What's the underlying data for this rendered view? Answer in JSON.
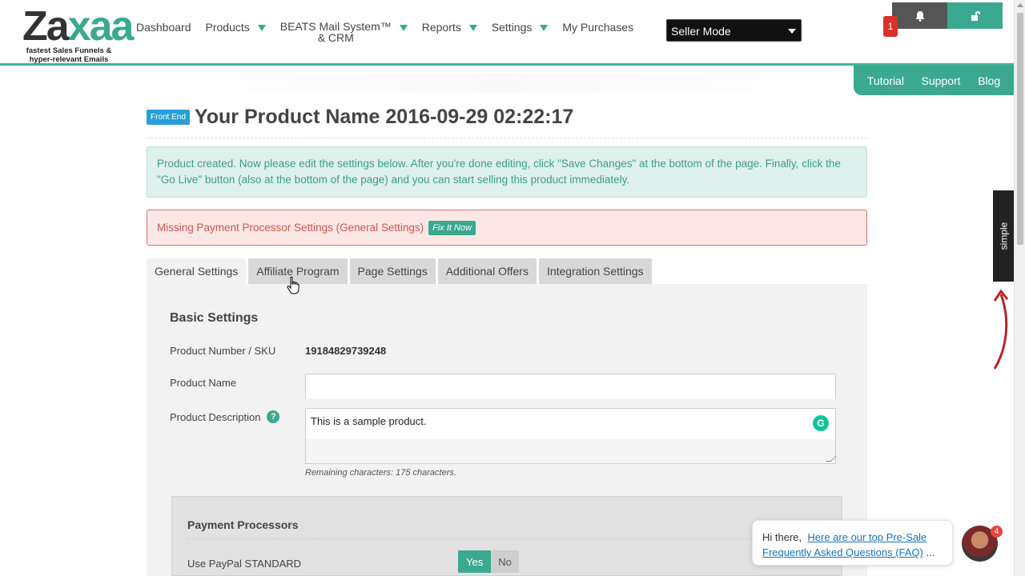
{
  "brand": {
    "logo_part1": "Za",
    "logo_part2": "xaa",
    "tagline_line1": "fastest Sales Funnels &",
    "tagline_line2": "hyper-relevant Emails"
  },
  "nav": {
    "dashboard": "Dashboard",
    "products": "Products",
    "beats_line1": "BEATS Mail System™",
    "beats_line2": "& CRM",
    "reports": "Reports",
    "settings": "Settings",
    "purchases": "My Purchases",
    "mode_selected": "Seller Mode",
    "notification_count": "1"
  },
  "subnav": {
    "tutorial": "Tutorial",
    "support": "Support",
    "blog": "Blog"
  },
  "product": {
    "badge": "Front End",
    "title": "Your Product Name 2016-09-29 02:22:17"
  },
  "alerts": {
    "success": "Product created. Now please edit the settings below. After you're done editing, click \"Save Changes\" at the bottom of the page. Finally, click the \"Go Live\" button (also at the bottom of the page) and you can start selling this product immediately.",
    "danger": "Missing Payment Processor Settings (General Settings)",
    "fix_button": "Fix It Now"
  },
  "tabs": [
    "General Settings",
    "Affiliate Program",
    "Page Settings",
    "Additional Offers",
    "Integration Settings"
  ],
  "basic": {
    "heading": "Basic Settings",
    "sku_label": "Product Number / SKU",
    "sku_value": "19184829739248",
    "name_label": "Product Name",
    "desc_label": "Product Description",
    "help_glyph": "?",
    "desc_value": "This is a sample product.",
    "remaining": "Remaining characters: 175 characters."
  },
  "payment": {
    "heading": "Payment Processors",
    "paypal_label": "Use PayPal STANDARD",
    "yes": "Yes",
    "no": "No"
  },
  "side_widget": {
    "label": "simple"
  },
  "chat": {
    "greeting": "Hi there,",
    "link_text": "Here are our top Pre-Sale Frequently Asked Questions (FAQ)",
    "ellipsis": "...",
    "badge_count": "4"
  },
  "colors": {
    "accent": "#3aa98f",
    "danger": "#c9574b",
    "info_badge": "#2a9fd6"
  }
}
